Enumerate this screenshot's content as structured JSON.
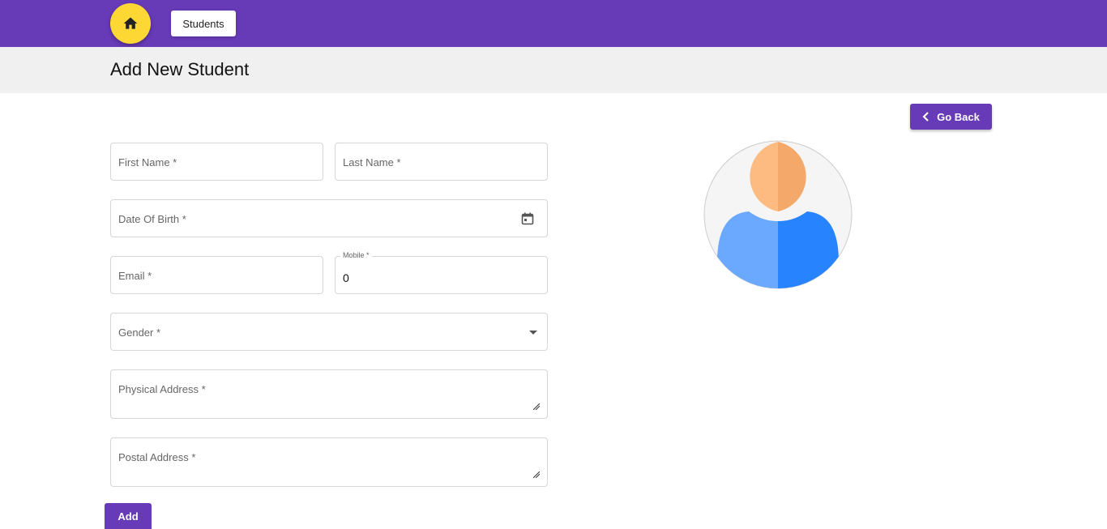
{
  "header": {
    "home_icon": "home-icon",
    "students_label": "Students",
    "background": "#673ab7",
    "home_color": "#fdd835"
  },
  "page": {
    "title": "Add New Student",
    "go_back_label": "Go Back"
  },
  "form": {
    "first_name_label": "First Name *",
    "last_name_label": "Last Name *",
    "dob_label": "Date Of Birth *",
    "email_label": "Email *",
    "mobile_label": "Mobile *",
    "mobile_value": "0",
    "gender_label": "Gender *",
    "physical_address_label": "Physical Address *",
    "postal_address_label": "Postal Address *",
    "add_label": "Add"
  },
  "avatar": {
    "icon": "user-avatar-icon"
  }
}
